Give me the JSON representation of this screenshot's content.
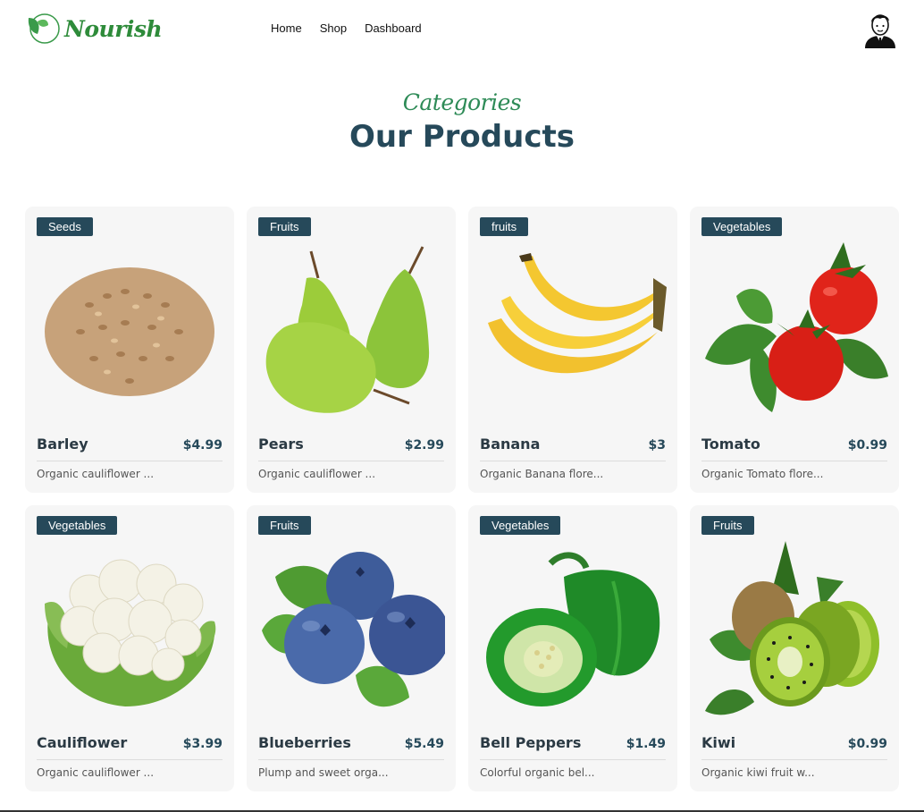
{
  "brand": {
    "name": "Nourish",
    "color": "#2e8b3a"
  },
  "nav": {
    "items": [
      "Home",
      "Shop",
      "Dashboard"
    ]
  },
  "avatar_icon": "user-avatar-icon",
  "section": {
    "subtitle": "Categories",
    "title": "Our Products"
  },
  "colors": {
    "badge": "#26495a",
    "title": "#26495a",
    "subtitle": "#2e8b57",
    "card_bg": "#f6f6f6"
  },
  "products": [
    {
      "category": "Seeds",
      "name": "Barley",
      "price": "$4.99",
      "description": "Organic cauliflower ...",
      "image": "barley-image"
    },
    {
      "category": "Fruits",
      "name": "Pears",
      "price": "$2.99",
      "description": "Organic cauliflower ...",
      "image": "pears-image"
    },
    {
      "category": "fruits",
      "name": "Banana",
      "price": "$3",
      "description": "Organic Banana flore...",
      "image": "banana-image"
    },
    {
      "category": "Vegetables",
      "name": "Tomato",
      "price": "$0.99",
      "description": "Organic Tomato flore...",
      "image": "tomato-image"
    },
    {
      "category": "Vegetables",
      "name": "Cauliflower",
      "price": "$3.99",
      "description": "Organic cauliflower ...",
      "image": "cauliflower-image"
    },
    {
      "category": "Fruits",
      "name": "Blueberries",
      "price": "$5.49",
      "description": "Plump and sweet orga...",
      "image": "blueberries-image"
    },
    {
      "category": "Vegetables",
      "name": "Bell Peppers",
      "price": "$1.49",
      "description": "Colorful organic bel...",
      "image": "bell-peppers-image"
    },
    {
      "category": "Fruits",
      "name": "Kiwi",
      "price": "$0.99",
      "description": "Organic kiwi fruit w...",
      "image": "kiwi-image"
    }
  ]
}
